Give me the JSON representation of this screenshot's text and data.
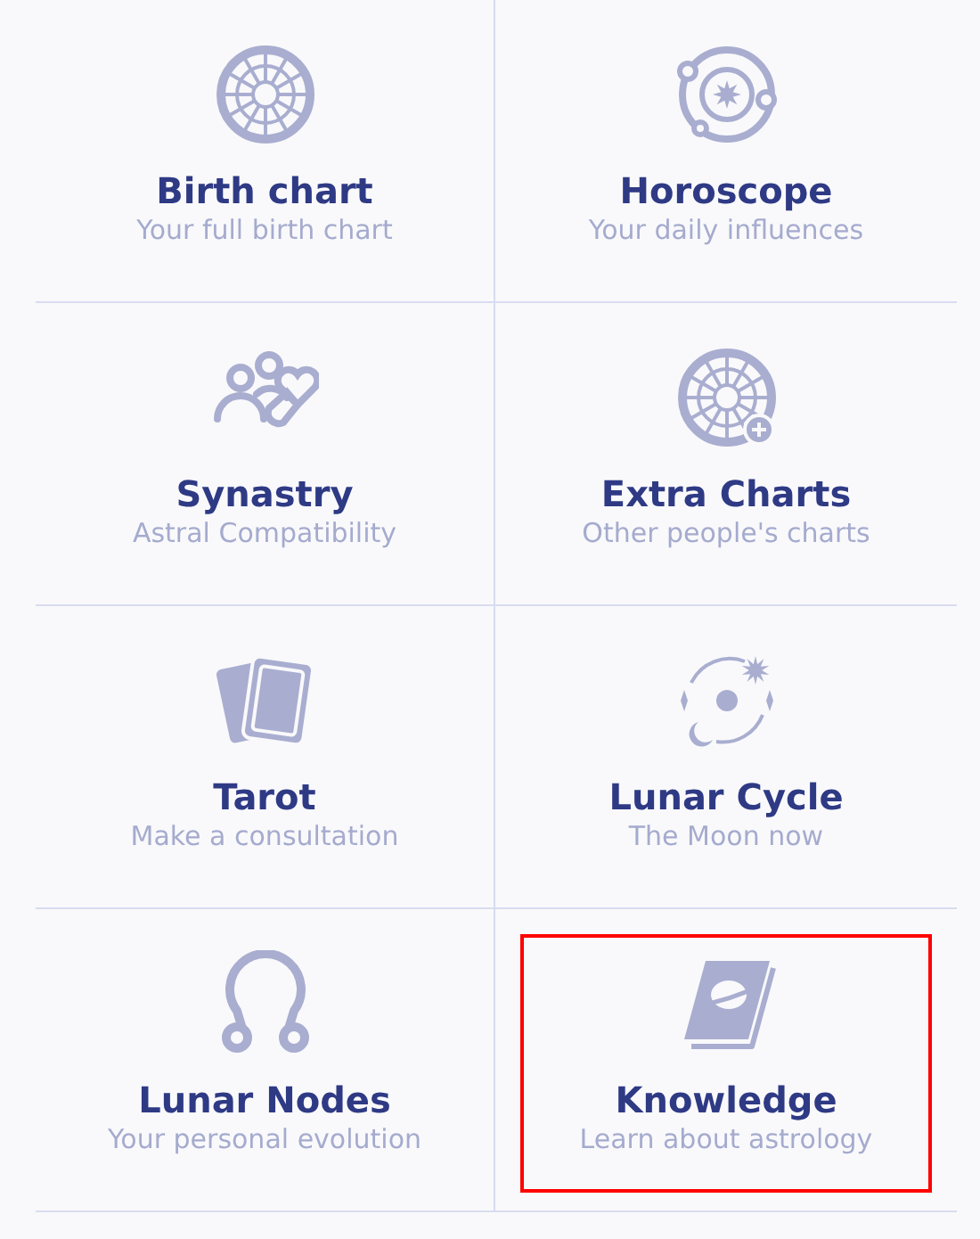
{
  "menu": [
    {
      "title": "Birth chart",
      "subtitle": "Your full birth chart",
      "selected": false
    },
    {
      "title": "Horoscope",
      "subtitle": "Your daily influences",
      "selected": false
    },
    {
      "title": "Synastry",
      "subtitle": "Astral Compatibility",
      "selected": false
    },
    {
      "title": "Extra Charts",
      "subtitle": "Other people's charts",
      "selected": false
    },
    {
      "title": "Tarot",
      "subtitle": "Make a consultation",
      "selected": false
    },
    {
      "title": "Lunar Cycle",
      "subtitle": "The Moon now",
      "selected": false
    },
    {
      "title": "Lunar Nodes",
      "subtitle": "Your personal evolution",
      "selected": false
    },
    {
      "title": "Knowledge",
      "subtitle": "Learn about astrology",
      "selected": true
    }
  ]
}
